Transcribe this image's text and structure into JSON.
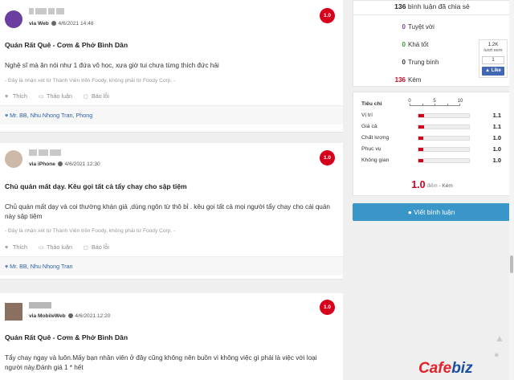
{
  "reviews": [
    {
      "via": "via Web",
      "date": "4/6/2021 14:48",
      "score": "1.0",
      "title": "Quán Rất Quê - Cơm & Phở Bình Dân",
      "body": "Nghệ sĩ mà ăn nói như 1 đứa vô học, xưa giờ tui chưa từng thích đức hải",
      "note": "- Đây là nhận xét từ Thành Viên trên Foody, không phải từ Foody Corp. -",
      "actions": {
        "like": "Thích",
        "discuss": "Thảo luận",
        "report": "Báo lỗi"
      },
      "likes": "Mr. BB, Nhu Nhong Tran, Phong",
      "avatar_color": "#6b3fa0"
    },
    {
      "via": "via iPhone",
      "date": "4/6/2021 12:30",
      "score": "1.0",
      "title": "Chủ quán mất dạy. Kêu gọi tất cả tẩy chay cho sập tiệm",
      "body": "Chủ quán mất dạy và coi thường khán giả ,dùng ngôn từ thô bỉ . kêu gọi tất cả mọi người tẩy chay cho cái quán này sập tiệm",
      "note": "- Đây là nhận xét từ Thành Viên trên Foody, không phải từ Foody Corp. -",
      "actions": {
        "like": "Thích",
        "discuss": "Thảo luận",
        "report": "Báo lỗi"
      },
      "likes": "Mr. BB, Nhu Nhong Tran",
      "avatar_color": "#cdb9a8"
    },
    {
      "via": "via MobileWeb",
      "date": "4/6/2021 12:20",
      "score": "1.0",
      "title": "Quán Rất Quê - Cơm & Phở Bình Dân",
      "body": "Tẩy chay ngay và luôn.Mấy bạn nhân viên ở đây cũng không nên buồn vì không việc gì phải là việc với loại người này.Đánh giá 1 * hết",
      "avatar_color": "#8a7060"
    }
  ],
  "summary": {
    "shared_count": "136",
    "shared_label": "bình luận đã chia sẻ",
    "rows": [
      {
        "count": "0",
        "label": "Tuyệt vời",
        "color": "#7b3fb0"
      },
      {
        "count": "0",
        "label": "Khá tốt",
        "color": "#2e9e2e"
      },
      {
        "count": "0",
        "label": "Trung bình",
        "color": "#333333"
      },
      {
        "count": "136",
        "label": "Kém",
        "color": "#d6001c"
      }
    ]
  },
  "criteria": {
    "header": "Tiêu chí",
    "scale": [
      "0",
      "5",
      "10"
    ],
    "rows": [
      {
        "label": "Vị trí",
        "value": "1.1",
        "fraction": 0.11
      },
      {
        "label": "Giá cả",
        "value": "1.1",
        "fraction": 0.11
      },
      {
        "label": "Chất lượng",
        "value": "1.0",
        "fraction": 0.1
      },
      {
        "label": "Phục vụ",
        "value": "1.0",
        "fraction": 0.1
      },
      {
        "label": "Không gian",
        "value": "1.0",
        "fraction": 0.1
      }
    ],
    "average": "1.0",
    "average_unit": "điểm",
    "average_label": "- Kém"
  },
  "write_button": "Viết bình luận",
  "facebook": {
    "count": "1.2K",
    "label": "lượt xem",
    "num": "1",
    "like": "Like"
  },
  "watermark": {
    "part1": "C",
    "part2": "afe",
    "part3": "biz"
  },
  "colors": {
    "score_red": "#d6001c",
    "button_blue": "#3a95c9",
    "link_blue": "#2f5fa8"
  }
}
